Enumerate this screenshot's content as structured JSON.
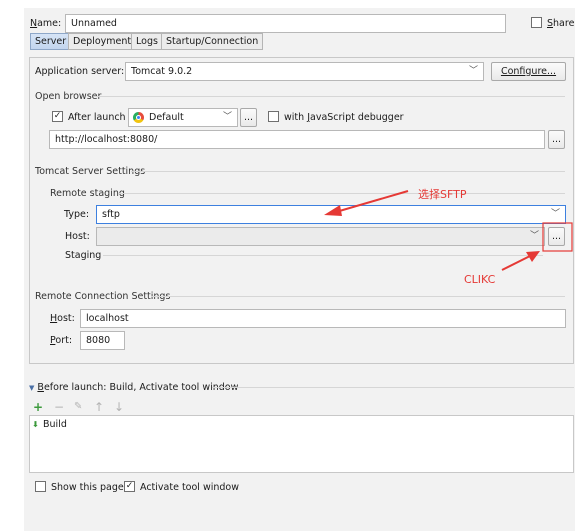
{
  "header": {
    "name_label_u": "N",
    "name_label_rest": "ame:",
    "name_value": "Unnamed",
    "share_label_u": "S",
    "share_label_rest": "hare",
    "share_checked": false
  },
  "tabs": [
    {
      "label": "Server",
      "active": true
    },
    {
      "label": "Deployment",
      "active": false
    },
    {
      "label": "Logs",
      "active": false
    },
    {
      "label": "Startup/Connection",
      "active": false
    }
  ],
  "server": {
    "app_server_label": "Application server:",
    "app_server_value": "Tomcat 9.0.2",
    "configure_label": "Configure...",
    "open_browser_title": "Open browser",
    "after_launch_label": "After launch",
    "after_launch_checked": true,
    "browser_value": "Default",
    "ellipsis": "...",
    "js_debugger_pre": "with ",
    "js_debugger_u": "J",
    "js_debugger_rest": "avaScript debugger",
    "js_debugger_checked": false,
    "url_value": "http://localhost:8080/",
    "tomcat_settings_title": "Tomcat Server Settings",
    "remote_staging_title": "Remote staging",
    "type_label": "Type:",
    "type_value": "sftp",
    "host_label": "Host:",
    "host_value": "",
    "staging_label": "Staging",
    "remote_conn_title": "Remote Connection Settings",
    "rc_host_label_u": "H",
    "rc_host_label_rest": "ost:",
    "rc_host_value": "localhost",
    "rc_port_label_u": "P",
    "rc_port_label_rest": "ort:",
    "rc_port_value": "8080"
  },
  "before_launch": {
    "title_u": "B",
    "title_rest": "efore launch: Build, Activate tool window",
    "toolbar": [
      "+",
      "−",
      "✎",
      "↑",
      "↓"
    ],
    "items": [
      {
        "label": "Build"
      }
    ]
  },
  "footer": {
    "show_page_label": "Show this page",
    "show_page_checked": false,
    "activate_tool_label": "Activate tool window",
    "activate_tool_checked": true
  },
  "annotations": {
    "select_sftp": "选择SFTP",
    "click": "CLIKC"
  },
  "colors": {
    "annotation_red": "#e53935",
    "selection_blue": "#3d80df",
    "add_green": "#3c9a3c"
  }
}
